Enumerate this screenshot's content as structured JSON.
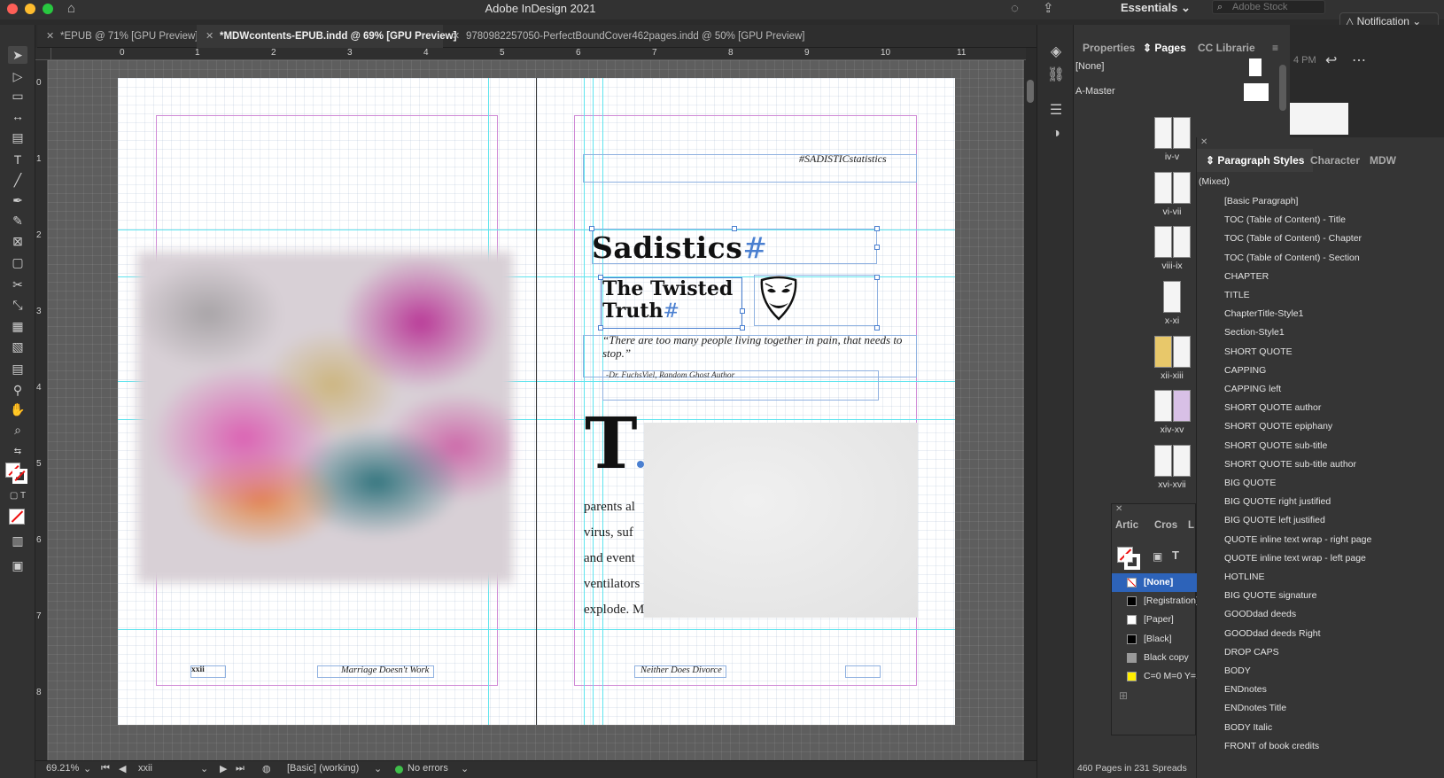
{
  "app": {
    "title": "Adobe InDesign 2021",
    "workspace": "Essentials",
    "search_placeholder": "Adobe Stock",
    "notification": "Notification"
  },
  "tabs": [
    {
      "label": "*EPUB @ 71% [GPU Preview]"
    },
    {
      "label": "*MDWcontents-EPUB.indd @ 69% [GPU Preview]"
    },
    {
      "label": "9780982257050-PerfectBoundCover462pages.indd @ 50% [GPU Preview]"
    }
  ],
  "ruler": {
    "top": [
      "0",
      "1",
      "2",
      "3",
      "4",
      "5",
      "6",
      "7",
      "8",
      "9",
      "10",
      "11"
    ],
    "left": [
      "0",
      "1",
      "2",
      "3",
      "4",
      "5",
      "6",
      "7",
      "8"
    ]
  },
  "document": {
    "hashtag": "#SADISTICstatistics",
    "title": "Sadistics",
    "subtitle": "The Twisted Truth",
    "quote": "“There are too many people living together in pain, that needs to stop.”",
    "attribution": "-Dr. FuchsViel, Random Ghost Author",
    "dropcap": "T",
    "body_lines": [
      "parents al",
      "virus,  suf",
      "and  event",
      "ventilators",
      "explode.  M"
    ],
    "footer_left_page": "xxii",
    "footer_left_running": "Marriage Doesn't Work",
    "footer_right_running": "Neither Does Divorce"
  },
  "status": {
    "zoom": "69.21%",
    "page": "xxii",
    "preflight_profile": "[Basic] (working)",
    "errors": "No errors"
  },
  "pages_panel": {
    "tabs": [
      "Properties",
      "Pages",
      "CC Librarie"
    ],
    "masters": [
      "[None]",
      "A-Master"
    ],
    "spreads": [
      "iv-v",
      "vi-vii",
      "viii-ix",
      "x-xi",
      "xii-xiii",
      "xiv-xv",
      "xvi-xvii"
    ],
    "count": "460 Pages in 231 Spreads"
  },
  "right_extra": {
    "time": "4 PM"
  },
  "swatches_panel": {
    "tabs": [
      "Artic",
      "Cros",
      "L"
    ],
    "items": [
      {
        "name": "[None]",
        "color": "none"
      },
      {
        "name": "[Registration]",
        "color": "#000000"
      },
      {
        "name": "[Paper]",
        "color": "#ffffff"
      },
      {
        "name": "[Black]",
        "color": "#000000"
      },
      {
        "name": "Black copy",
        "color": "#9a9a9a"
      },
      {
        "name": "C=0 M=0 Y=100 K=0",
        "color": "#ffee00"
      }
    ]
  },
  "paragraph_styles": {
    "tabs": [
      "Paragraph Styles",
      "Character",
      "MDW"
    ],
    "current": "(Mixed)",
    "styles": [
      "[Basic Paragraph]",
      "TOC (Table of Content) - Title",
      "TOC (Table of Content) - Chapter",
      "TOC (Table of Content) - Section",
      "CHAPTER",
      "TITLE",
      "ChapterTitle-Style1",
      "Section-Style1",
      "SHORT QUOTE",
      "CAPPING",
      "CAPPING left",
      "SHORT QUOTE author",
      "SHORT QUOTE epiphany",
      "SHORT QUOTE sub-title",
      "SHORT QUOTE sub-title author",
      "BIG QUOTE",
      "BIG QUOTE right justified",
      "BIG QUOTE left justified",
      "QUOTE inline text wrap - right page",
      "QUOTE inline text wrap - left page",
      "HOTLINE",
      "BIG QUOTE signature",
      "GOODdad deeds",
      "GOODdad deeds Right",
      "DROP CAPS",
      "BODY",
      "ENDnotes",
      "ENDnotes Title",
      "BODY Italic",
      "FRONT of book credits"
    ]
  }
}
